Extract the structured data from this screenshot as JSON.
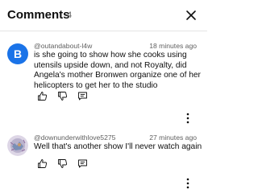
{
  "header": {
    "title": "Comments",
    "count": "4"
  },
  "comments": [
    {
      "avatar_letter": "B",
      "avatar_color": "#1a73e8",
      "author": "@outandabout-l4w",
      "time": "18 minutes ago",
      "text": "is she going to show how she cooks using utensils upside down, and not Royalty, did Angela's mother Bronwen organize one of her helicopters to get her to the studio"
    },
    {
      "avatar_letter": "",
      "avatar_color": "#c9c4d8",
      "author": "@downunderwithlove5275",
      "time": "27 minutes ago",
      "text": "Well that's another show I'll never watch again"
    }
  ],
  "icons": {
    "close": "close-icon",
    "like": "thumb-up-icon",
    "dislike": "thumb-down-icon",
    "reply": "reply-icon",
    "more": "more-vertical-icon"
  }
}
